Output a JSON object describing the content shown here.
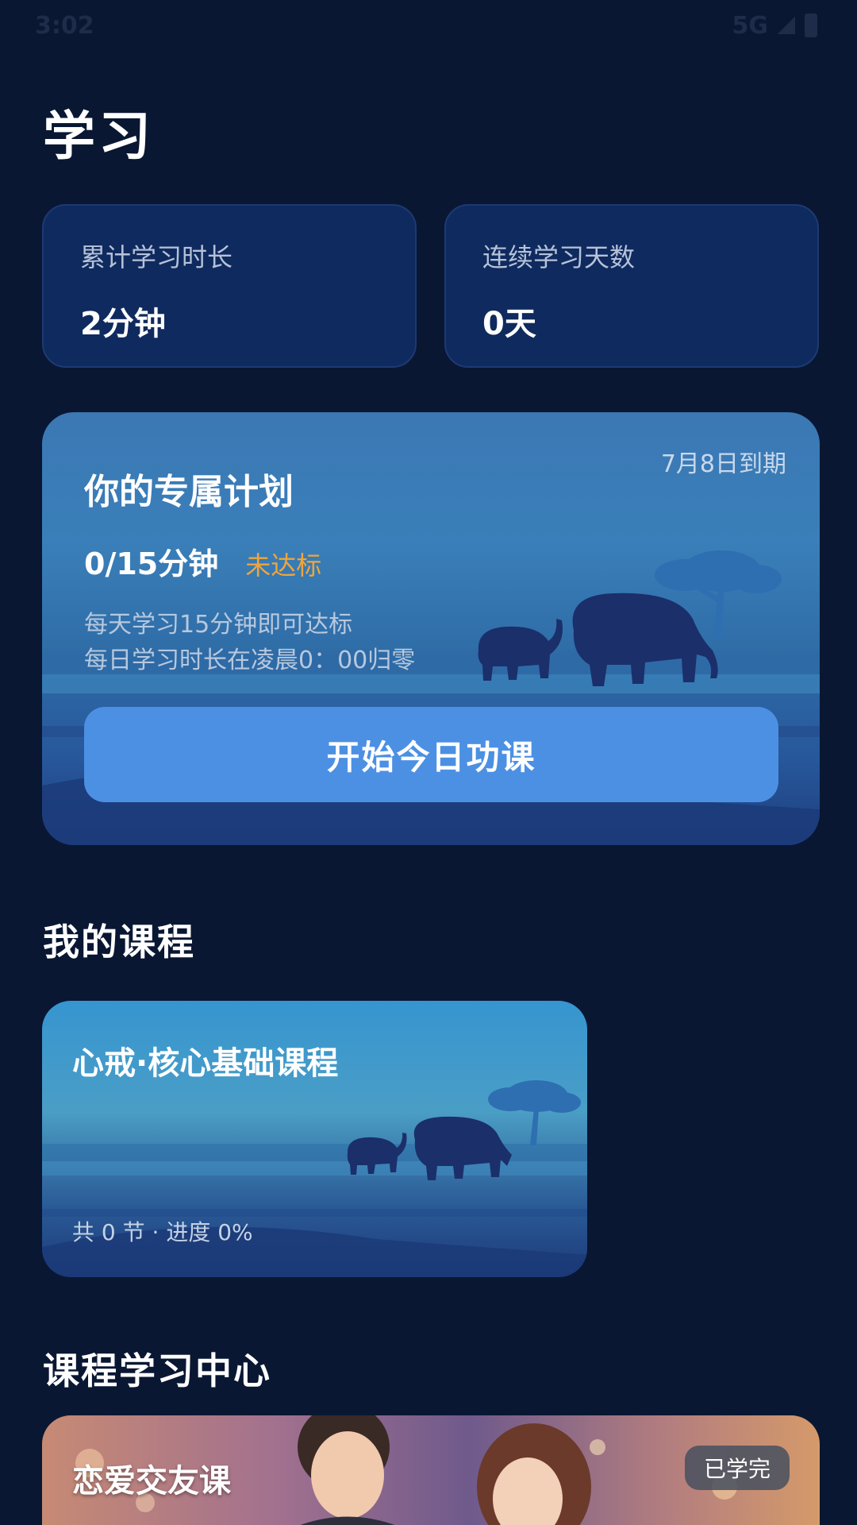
{
  "status_bar": {
    "time": "3:02",
    "network": "5G"
  },
  "page": {
    "title": "学习"
  },
  "stats": {
    "total_label": "累计学习时长",
    "total_value": "2分钟",
    "streak_label": "连续学习天数",
    "streak_value": "0天"
  },
  "plan": {
    "title": "你的专属计划",
    "expiry": "7月8日到期",
    "progress": "0/15分钟",
    "status": "未达标",
    "note1": "每天学习15分钟即可达标",
    "note2": "每日学习时长在凌晨0：00归零",
    "button": "开始今日功课"
  },
  "my_courses": {
    "section_title": "我的课程",
    "course": {
      "title": "心戒·核心基础课程",
      "meta": "共 0 节 · 进度 0%"
    }
  },
  "learning_center": {
    "section_title": "课程学习中心",
    "card": {
      "title": "恋爱交友课",
      "badge": "已学完"
    }
  },
  "colors": {
    "background": "#0a1733",
    "card": "#0f2a5e",
    "accent_button": "#4c90e4",
    "warning": "#f0a53a"
  }
}
